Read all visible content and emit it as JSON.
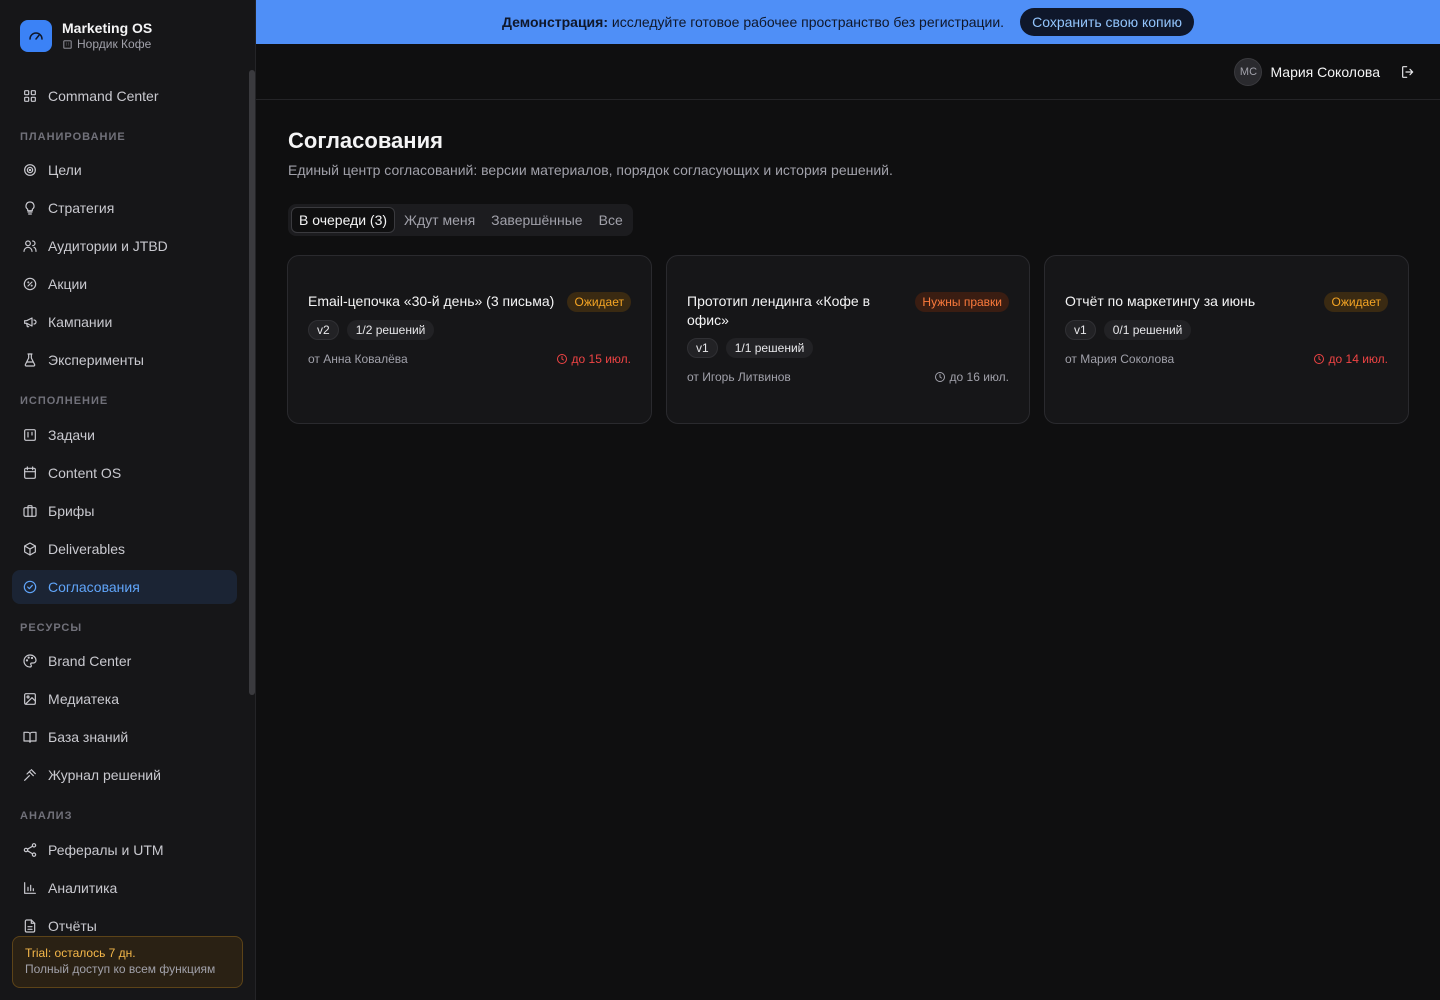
{
  "brand": {
    "name": "Marketing OS",
    "org": "Нордик Кофе"
  },
  "sidebar": {
    "top_item": "Command Center",
    "sections": [
      {
        "label": "ПЛАНИРОВАНИЕ",
        "items": [
          "Цели",
          "Стратегия",
          "Аудитории и JTBD",
          "Акции",
          "Кампании",
          "Эксперименты"
        ]
      },
      {
        "label": "ИСПОЛНЕНИЕ",
        "items": [
          "Задачи",
          "Content OS",
          "Брифы",
          "Deliverables",
          "Согласования"
        ]
      },
      {
        "label": "РЕСУРСЫ",
        "items": [
          "Brand Center",
          "Медиатека",
          "База знаний",
          "Журнал решений"
        ]
      },
      {
        "label": "АНАЛИЗ",
        "items": [
          "Рефералы и UTM",
          "Аналитика",
          "Отчёты"
        ]
      }
    ],
    "active_item": "Согласования",
    "trial": {
      "title": "Trial: осталось 7 дн.",
      "subtitle": "Полный доступ ко всем функциям"
    }
  },
  "banner": {
    "bold": "Демонстрация:",
    "text": "исследуйте готовое рабочее пространство без регистрации.",
    "button": "Сохранить свою копию"
  },
  "user": {
    "initials": "МС",
    "name": "Мария Соколова"
  },
  "page": {
    "title": "Согласования",
    "subtitle": "Единый центр согласований: версии материалов, порядок согласующих и история решений."
  },
  "tabs": [
    "В очереди (3)",
    "Ждут меня",
    "Завершённые",
    "Все"
  ],
  "cards": [
    {
      "title": "Email-цепочка «30-й день» (3 письма)",
      "status": "Ожидает",
      "version": "v2",
      "decisions": "1/2 решений",
      "author": "от Анна Ковалёва",
      "due": "до 15 июл."
    },
    {
      "title": "Прототип лендинга «Кофе в офис»",
      "status": "Нужны правки",
      "version": "v1",
      "decisions": "1/1 решений",
      "author": "от Игорь Литвинов",
      "due": "до 16 июл."
    },
    {
      "title": "Отчёт по маркетингу за июнь",
      "status": "Ожидает",
      "version": "v1",
      "decisions": "0/1 решений",
      "author": "от Мария Соколова",
      "due": "до 14 июл."
    }
  ],
  "colors": {
    "accent": "#3b82f6",
    "banner": "#4f8ff7",
    "overdue": "#ef4444",
    "pending": "#f5a524",
    "needs_fix": "#fb7a3c"
  }
}
